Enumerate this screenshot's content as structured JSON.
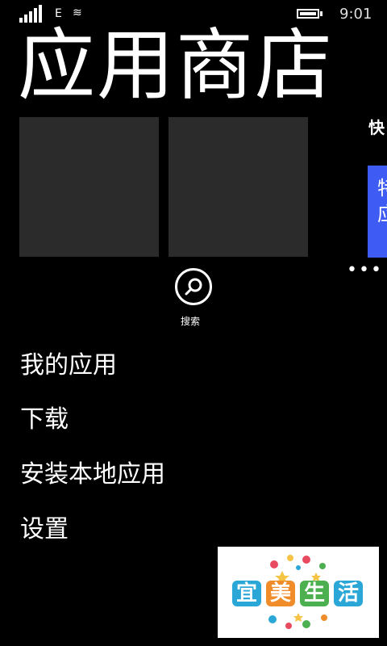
{
  "status_bar": {
    "network_type": "E",
    "time": "9:01",
    "icons": [
      "signal-icon",
      "data-icon",
      "battery-icon"
    ]
  },
  "page": {
    "title": "应用商店"
  },
  "peek": {
    "label": "快",
    "card_line1": "特",
    "card_line2": "应"
  },
  "search": {
    "label": "搜索"
  },
  "menu": {
    "items": [
      {
        "label": "我的应用"
      },
      {
        "label": "下载"
      },
      {
        "label": "安装本地应用"
      },
      {
        "label": "设置"
      }
    ]
  },
  "watermark": {
    "chars": [
      "宜",
      "美",
      "生",
      "活"
    ],
    "colors": [
      "#2aa7d6",
      "#f08c2a",
      "#4caf50",
      "#2aa7d6"
    ]
  },
  "colors": {
    "background": "#000000",
    "tile": "#2b2b2b",
    "accent": "#3e5cf3"
  }
}
